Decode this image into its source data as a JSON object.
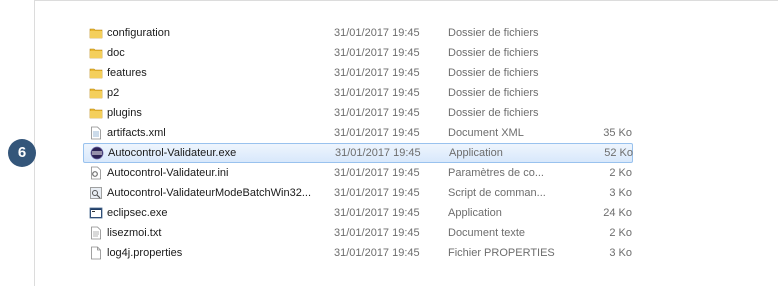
{
  "step_badge": "6",
  "files": [
    {
      "name": "configuration",
      "date": "31/01/2017 19:45",
      "type": "Dossier de fichiers",
      "size": "",
      "icon": "folder-icon"
    },
    {
      "name": "doc",
      "date": "31/01/2017 19:45",
      "type": "Dossier de fichiers",
      "size": "",
      "icon": "folder-icon"
    },
    {
      "name": "features",
      "date": "31/01/2017 19:45",
      "type": "Dossier de fichiers",
      "size": "",
      "icon": "folder-icon"
    },
    {
      "name": "p2",
      "date": "31/01/2017 19:45",
      "type": "Dossier de fichiers",
      "size": "",
      "icon": "folder-icon"
    },
    {
      "name": "plugins",
      "date": "31/01/2017 19:45",
      "type": "Dossier de fichiers",
      "size": "",
      "icon": "folder-icon"
    },
    {
      "name": "artifacts.xml",
      "date": "31/01/2017 19:45",
      "type": "Document XML",
      "size": "35 Ko",
      "icon": "xml-file-icon"
    },
    {
      "name": "Autocontrol-Validateur.exe",
      "date": "31/01/2017 19:45",
      "type": "Application",
      "size": "52 Ko",
      "icon": "eclipse-app-icon",
      "selected": true
    },
    {
      "name": "Autocontrol-Validateur.ini",
      "date": "31/01/2017 19:45",
      "type": "Paramètres de co...",
      "size": "2 Ko",
      "icon": "settings-file-icon"
    },
    {
      "name": "Autocontrol-ValidateurModeBatchWin32...",
      "date": "31/01/2017 19:45",
      "type": "Script de comman...",
      "size": "3 Ko",
      "icon": "script-file-icon"
    },
    {
      "name": "eclipsec.exe",
      "date": "31/01/2017 19:45",
      "type": "Application",
      "size": "24 Ko",
      "icon": "console-app-icon"
    },
    {
      "name": "lisezmoi.txt",
      "date": "31/01/2017 19:45",
      "type": "Document texte",
      "size": "2 Ko",
      "icon": "text-file-icon"
    },
    {
      "name": "log4j.properties",
      "date": "31/01/2017 19:45",
      "type": "Fichier PROPERTIES",
      "size": "3 Ko",
      "icon": "blank-file-icon"
    }
  ],
  "colors": {
    "folder": "#e8b731",
    "selection_border": "#99c2ee",
    "badge": "#34567a"
  }
}
